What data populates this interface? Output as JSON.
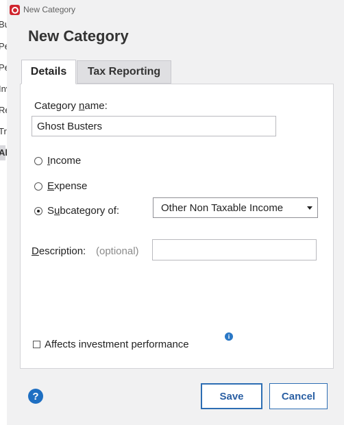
{
  "window": {
    "title": "New Category"
  },
  "dialog": {
    "heading": "New Category"
  },
  "tabs": [
    {
      "label": "Details",
      "active": true
    },
    {
      "label": "Tax Reporting",
      "active": false
    }
  ],
  "background_list": [
    "Bu",
    "Pe",
    "Pe",
    "Inv",
    "Re",
    "Tra",
    "Al"
  ],
  "form": {
    "category_name_label_prefix": "Category ",
    "category_name_label_underlined": "n",
    "category_name_label_suffix": "ame:",
    "category_name_value": "Ghost Busters",
    "income_label_underlined": "I",
    "income_label_rest": "ncome",
    "expense_label_underlined": "E",
    "expense_label_rest": "xpense",
    "subcategory_label_prefix": "S",
    "subcategory_label_underlined": "u",
    "subcategory_label_rest": "bcategory of:",
    "selected_type": "subcategory",
    "subcategory_value": "Other Non Taxable Income",
    "description_label_underlined": "D",
    "description_label_rest": "escription:",
    "description_hint": "(optional)",
    "description_value": "",
    "affects_investment_label": "Affects investment performance",
    "affects_investment_checked": false
  },
  "buttons": {
    "help": "?",
    "save": "Save",
    "cancel": "Cancel"
  },
  "colors": {
    "accent": "#2a5fa3",
    "app_icon": "#d0252e",
    "info": "#2a78c6"
  }
}
